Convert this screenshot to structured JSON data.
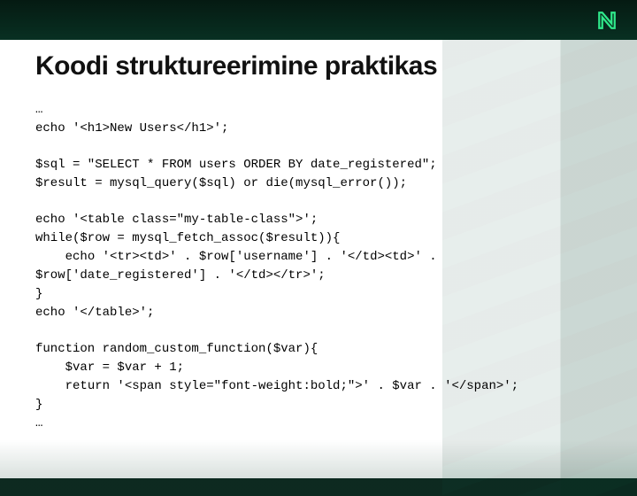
{
  "topbar": {
    "logo_name": "N"
  },
  "slide": {
    "title": "Koodi struktureerimine praktikas",
    "code_blocks": [
      "…\necho '<h1>New Users</h1>';",
      "$sql = \"SELECT * FROM users ORDER BY date_registered\";\n$result = mysql_query($sql) or die(mysql_error());",
      "echo '<table class=\"my-table-class\">';\nwhile($row = mysql_fetch_assoc($result)){\n    echo '<tr><td>' . $row['username'] . '</td><td>' . $row['date_registered'] . '</td></tr>';\n}\necho '</table>';",
      "function random_custom_function($var){\n    $var = $var + 1;\n    return '<span style=\"font-weight:bold;\">' . $var . '</span>';\n}\n…"
    ]
  }
}
